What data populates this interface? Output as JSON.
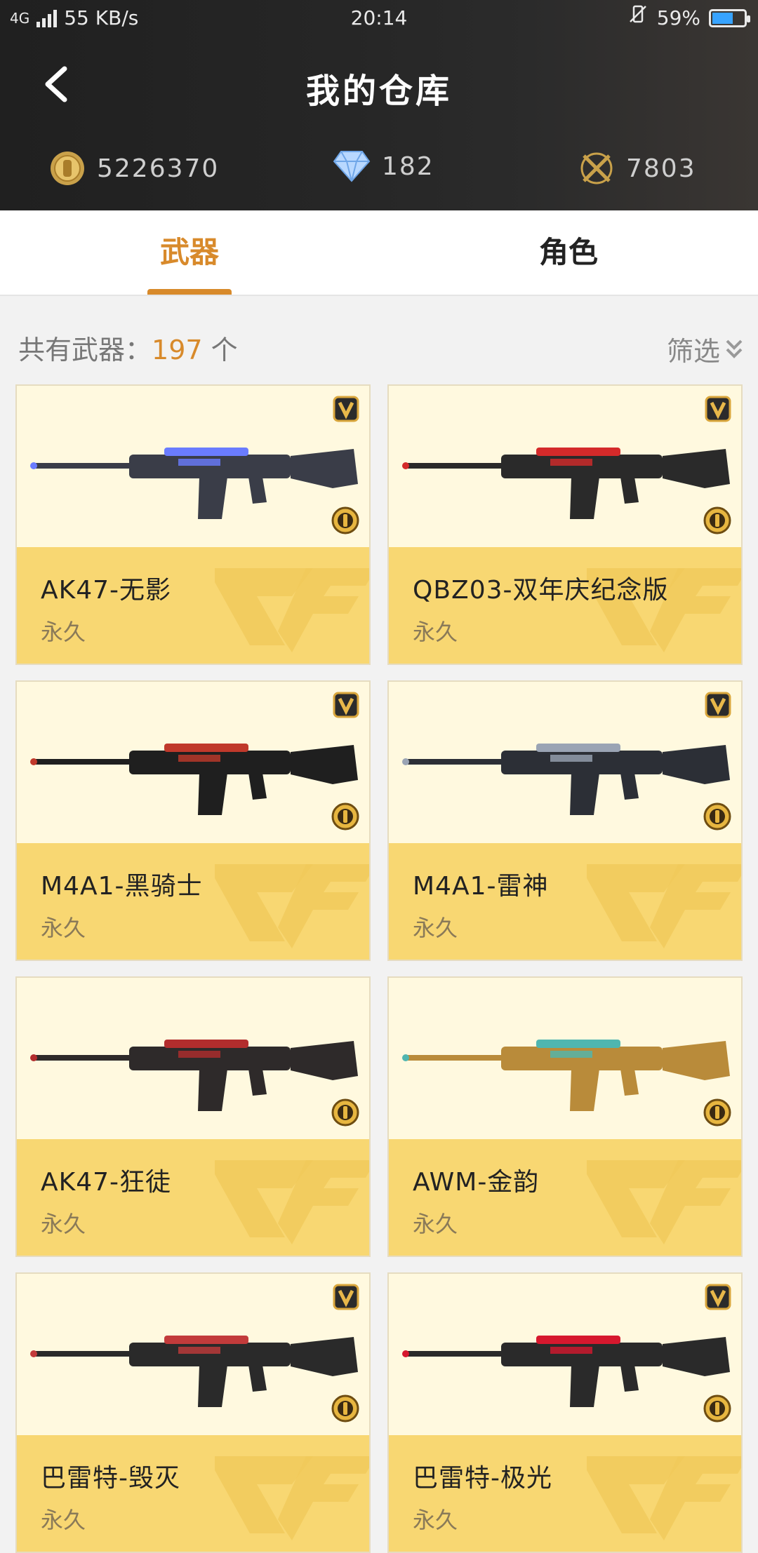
{
  "status": {
    "network": "4G",
    "speed": "55 KB/s",
    "time": "20:14",
    "battery": "59%",
    "battery_level": 0.59
  },
  "header": {
    "title": "我的仓库",
    "back_icon": "chevron-left-icon"
  },
  "currencies": [
    {
      "name": "gold",
      "icon": "gold-coin-icon",
      "value": "5226370"
    },
    {
      "name": "diamond",
      "icon": "diamond-icon",
      "value": "182"
    },
    {
      "name": "crossfire",
      "icon": "crossed-guns-icon",
      "value": "7803"
    }
  ],
  "tabs": [
    {
      "label": "武器",
      "active": true
    },
    {
      "label": "角色",
      "active": false
    }
  ],
  "summary": {
    "prefix": "共有武器：",
    "count": "197",
    "suffix": " 个",
    "filter_label": "筛选"
  },
  "colors": {
    "accent": "#d88a2b",
    "card_top": "#fff9df",
    "card_bottom": "#f8d772"
  },
  "weapons": [
    {
      "name": "AK47-无影",
      "duration": "永久",
      "gun_color": "#3a3d48",
      "accent": "#6a7cff"
    },
    {
      "name": "QBZ03-双年庆纪念版",
      "duration": "永久",
      "gun_color": "#2a2a2a",
      "accent": "#d42a2a"
    },
    {
      "name": "M4A1-黑骑士",
      "duration": "永久",
      "gun_color": "#1f1f1f",
      "accent": "#c0392b"
    },
    {
      "name": "M4A1-雷神",
      "duration": "永久",
      "gun_color": "#2c2f36",
      "accent": "#9aa4b4"
    },
    {
      "name": "AK47-狂徒",
      "duration": "永久",
      "gun_color": "#2e2a2a",
      "accent": "#b22d2d"
    },
    {
      "name": "AWM-金韵",
      "duration": "永久",
      "gun_color": "#b98b3a",
      "accent": "#4fb6b0"
    },
    {
      "name": "巴雷特-毁灭",
      "duration": "永久",
      "gun_color": "#2a2a2a",
      "accent": "#c23b3b"
    },
    {
      "name": "巴雷特-极光",
      "duration": "永久",
      "gun_color": "#2a2a2a",
      "accent": "#d6182e"
    }
  ]
}
